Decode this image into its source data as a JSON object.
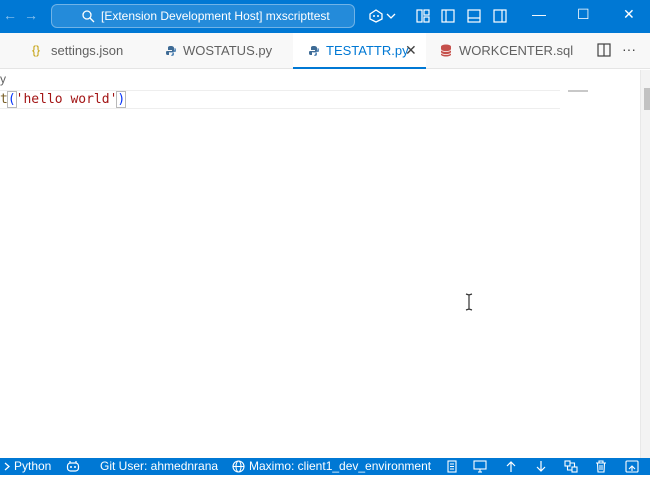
{
  "titlebar": {
    "search_text": "[Extension Development Host] mxscripttest",
    "back_arrow": "←",
    "forward_arrow": "→",
    "minimize_glyph": "—",
    "maximize_glyph": "☐",
    "close_glyph": "✕"
  },
  "tabs": [
    {
      "label": "settings.json",
      "icon": "json-braces-icon",
      "icon_glyph": "{}",
      "active": false
    },
    {
      "label": "WOSTATUS.py",
      "icon": "python-icon",
      "active": false
    },
    {
      "label": "TESTATTR.py",
      "icon": "python-icon",
      "active": true,
      "close_glyph": "✕"
    },
    {
      "label": "WORKCENTER.sql",
      "icon": "database-icon",
      "active": false
    }
  ],
  "tab_actions": {
    "more_glyph": "···"
  },
  "breadcrumb": {
    "text": "y"
  },
  "editor": {
    "line1": {
      "fn": "t",
      "open": "(",
      "str": "'hello world'",
      "close": ")"
    }
  },
  "statusbar": {
    "python": "Python",
    "git_user": "Git User: ahmednrana",
    "maximo": "Maximo: client1_dev_environment"
  },
  "colors": {
    "accent": "#0078d4",
    "string": "#a31515",
    "function": "#795e26",
    "bracket": "#0431fa"
  }
}
